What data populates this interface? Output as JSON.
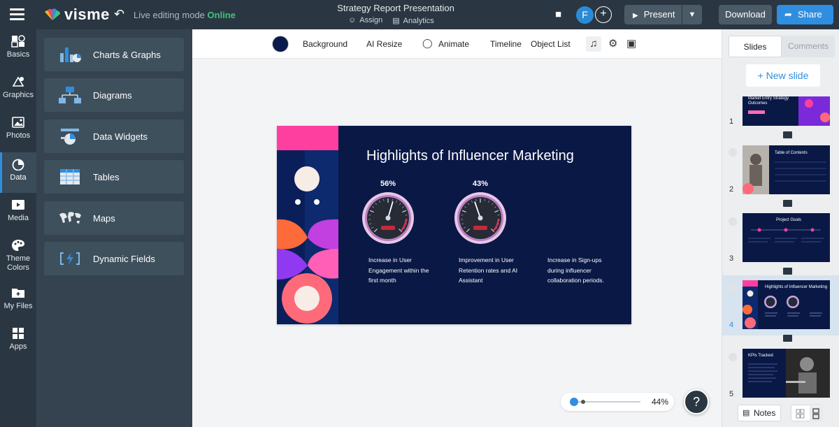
{
  "topbar": {
    "logo_text": "visme",
    "live_mode_prefix": "Live editing mode",
    "live_mode_status": "Online",
    "doc_title": "Strategy Report Presentation",
    "assign_label": "Assign",
    "analytics_label": "Analytics",
    "avatar_initial": "F",
    "present_label": "Present",
    "download_label": "Download",
    "share_label": "Share"
  },
  "rail": {
    "items": [
      {
        "label": "Basics",
        "icon": "shapes-icon"
      },
      {
        "label": "Graphics",
        "icon": "graphics-icon"
      },
      {
        "label": "Photos",
        "icon": "image-icon"
      },
      {
        "label": "Data",
        "icon": "pie-chart-icon",
        "active": true
      },
      {
        "label": "Media",
        "icon": "media-icon"
      },
      {
        "label": "Theme Colors",
        "icon": "palette-icon"
      },
      {
        "label": "My Files",
        "icon": "folder-icon"
      },
      {
        "label": "Apps",
        "icon": "apps-icon"
      }
    ]
  },
  "panel": {
    "items": [
      {
        "label": "Charts & Graphs",
        "icon": "charts-icon"
      },
      {
        "label": "Diagrams",
        "icon": "diagram-icon"
      },
      {
        "label": "Data Widgets",
        "icon": "widgets-icon"
      },
      {
        "label": "Tables",
        "icon": "table-icon"
      },
      {
        "label": "Maps",
        "icon": "map-icon"
      },
      {
        "label": "Dynamic Fields",
        "icon": "dynamic-fields-icon"
      }
    ]
  },
  "toolbar": {
    "background_label": "Background",
    "ai_resize_label": "AI Resize",
    "animate_label": "Animate",
    "timeline_label": "Timeline",
    "object_list_label": "Object List",
    "background_color": "#0a1a4a"
  },
  "slide": {
    "title": "Highlights of Influencer Marketing",
    "gauges": [
      {
        "percent_label": "56%",
        "value": 0.56
      },
      {
        "percent_label": "43%",
        "value": 0.43
      }
    ],
    "texts": [
      "Increase in User Engagement within the first month",
      "Improvement in User Retention rates and AI Assistant",
      "Increase in Sign-ups during influencer collaboration periods."
    ]
  },
  "zoom": {
    "value_label": "44%",
    "value": 0.44
  },
  "help_label": "?",
  "sidebar": {
    "tab_slides": "Slides",
    "tab_comments": "Comments",
    "new_slide_label": "+ New slide",
    "notes_label": "Notes",
    "thumbnails": [
      {
        "number": "1",
        "title": "Market Entry Strategy Outcomes"
      },
      {
        "number": "2",
        "title": "Table of Contents"
      },
      {
        "number": "3",
        "title": "Project Goals"
      },
      {
        "number": "4",
        "title": "Highlights of Influencer Marketing",
        "active": true
      },
      {
        "number": "5",
        "title": "KPIs Tracked"
      }
    ]
  }
}
